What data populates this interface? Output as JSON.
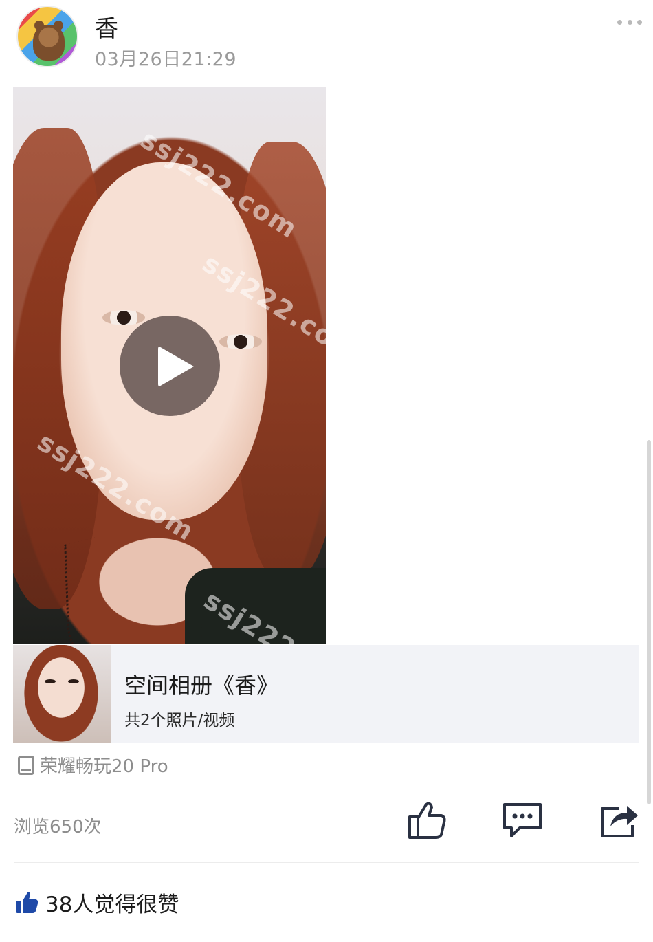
{
  "post": {
    "author": "香",
    "timestamp": "03月26日21:29",
    "more_icon": "more-dots-icon"
  },
  "video": {
    "watermark": "ssj222.com",
    "play_icon": "play-icon"
  },
  "album": {
    "title": "空间相册《香》",
    "count": "共2个照片/视频"
  },
  "device": {
    "icon": "phone-icon",
    "label": "荣耀畅玩20 Pro"
  },
  "stats": {
    "views": "浏览650次",
    "likes": "38人觉得很赞"
  },
  "actions": {
    "like_icon": "thumbs-up-icon",
    "comment_icon": "comment-icon",
    "share_icon": "share-icon"
  },
  "colors": {
    "text_primary": "#1c1c1c",
    "text_secondary": "#8d8d8d",
    "icon_dark": "#2a3142",
    "like_blue": "#1f4aa8",
    "card_bg": "#f2f3f7"
  }
}
